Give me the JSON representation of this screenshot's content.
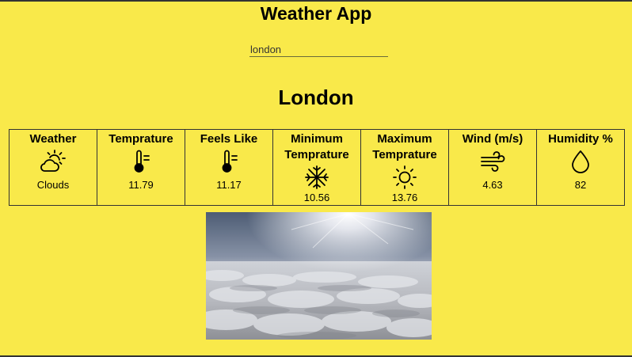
{
  "app": {
    "title": "Weather App"
  },
  "search": {
    "value": "london"
  },
  "city": {
    "name": "London"
  },
  "stats": [
    {
      "label": "Weather",
      "value": "Clouds",
      "icon": "partly-cloudy-icon"
    },
    {
      "label": "Temprature",
      "value": "11.79",
      "icon": "thermometer-icon"
    },
    {
      "label": "Feels Like",
      "value": "11.17",
      "icon": "thermometer-icon"
    },
    {
      "label": "Minimum Temprature",
      "value": "10.56",
      "icon": "snowflake-icon"
    },
    {
      "label": "Maximum Temprature",
      "value": "13.76",
      "icon": "sun-icon"
    },
    {
      "label": "Wind (m/s)",
      "value": "4.63",
      "icon": "wind-icon"
    },
    {
      "label": "Humidity %",
      "value": "82",
      "icon": "droplet-icon"
    }
  ],
  "colors": {
    "background": "#f9e94a",
    "text": "#000000",
    "border": "#333333"
  }
}
